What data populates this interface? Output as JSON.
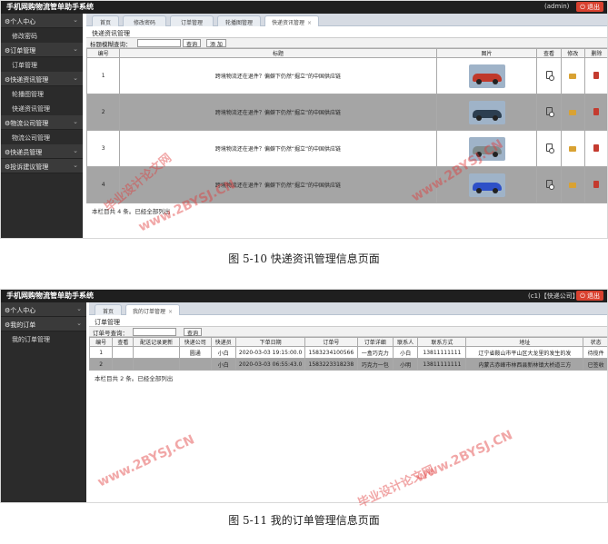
{
  "app_title": "手机网购物流管单助手系统",
  "screen1": {
    "user": "(admin)",
    "logout": "退出",
    "sidebar": [
      {
        "group": "个人中心",
        "items": [
          "修改密码"
        ]
      },
      {
        "group": "订单管理",
        "items": [
          "订单管理"
        ]
      },
      {
        "group": "快递资讯管理",
        "items": [
          "轮播图管理",
          "快递资讯管理"
        ]
      },
      {
        "group": "物流公司管理",
        "items": [
          "物流公司管理"
        ]
      },
      {
        "group": "快递员管理",
        "items": []
      },
      {
        "group": "投诉建议管理",
        "items": []
      }
    ],
    "tabs": [
      "首页",
      "修改密码",
      "订单管理",
      "轮播图管理",
      "快递资讯管理"
    ],
    "panel_title": "快递资讯管理",
    "search_label": "标题模糊查询：",
    "search_btn": "查询",
    "add_btn": "添 加",
    "columns": [
      "编号",
      "标题",
      "图片",
      "查看",
      "修改",
      "删除"
    ],
    "rows": [
      {
        "id": "1",
        "title": "跨境物流还在退件？偏僻下仍然“掘立”的中国供应链",
        "car_color": "#c0392b"
      },
      {
        "id": "2",
        "title": "跨境物流还在退件？偏僻下仍然“掘立”的中国供应链",
        "car_color": "#2c3e50"
      },
      {
        "id": "3",
        "title": "跨境物流还在退件？偏僻下仍然“掘立”的中国供应链",
        "car_color": "#7f8c8d"
      },
      {
        "id": "4",
        "title": "跨境物流还在退件？偏僻下仍然“掘立”的中国供应链",
        "car_color": "#2e50c8"
      }
    ],
    "footer": "本栏目共 4 条。已经全部列出",
    "caption": "图 5-10 快递资讯管理信息页面"
  },
  "screen2": {
    "user": "(c1)【快递公司】",
    "logout": "退出",
    "sidebar": [
      {
        "group": "个人中心",
        "items": []
      },
      {
        "group": "我的订单",
        "items": [
          "我的订单管理"
        ]
      }
    ],
    "tabs": [
      "首页",
      "我的订单管理"
    ],
    "panel_title": "订单管理",
    "search_label": "订单号查询：",
    "search_btn": "查询",
    "columns": [
      "编号",
      "查看",
      "配送记录更新",
      "快递公司",
      "快递员",
      "下单日期",
      "订单号",
      "订单详细",
      "联系人",
      "联系方式",
      "地址",
      "状态"
    ],
    "rows": [
      [
        "1",
        "",
        "",
        "圆通",
        "小白",
        "2020-03-03 19:15:00.0",
        "1583234100566",
        "一盒巧克力",
        "小白",
        "13811111111",
        "辽宁省鞍山市平山区大龙里的发生的发",
        "待揽件"
      ],
      [
        "2",
        "",
        "",
        "",
        "小白",
        "2020-03-03 06:55:43.0",
        "1583223318238",
        "巧克力一包",
        "小明",
        "13811111111",
        "内蒙古赤峰市林西县新林镇大桥道三方",
        "已签收"
      ]
    ],
    "footer": "本栏目共 2 条。已经全部列出",
    "caption": "图 5-11 我的订单管理信息页面"
  },
  "watermarks": [
    "www.2BYSJ.CN",
    "毕业设计论文网"
  ]
}
